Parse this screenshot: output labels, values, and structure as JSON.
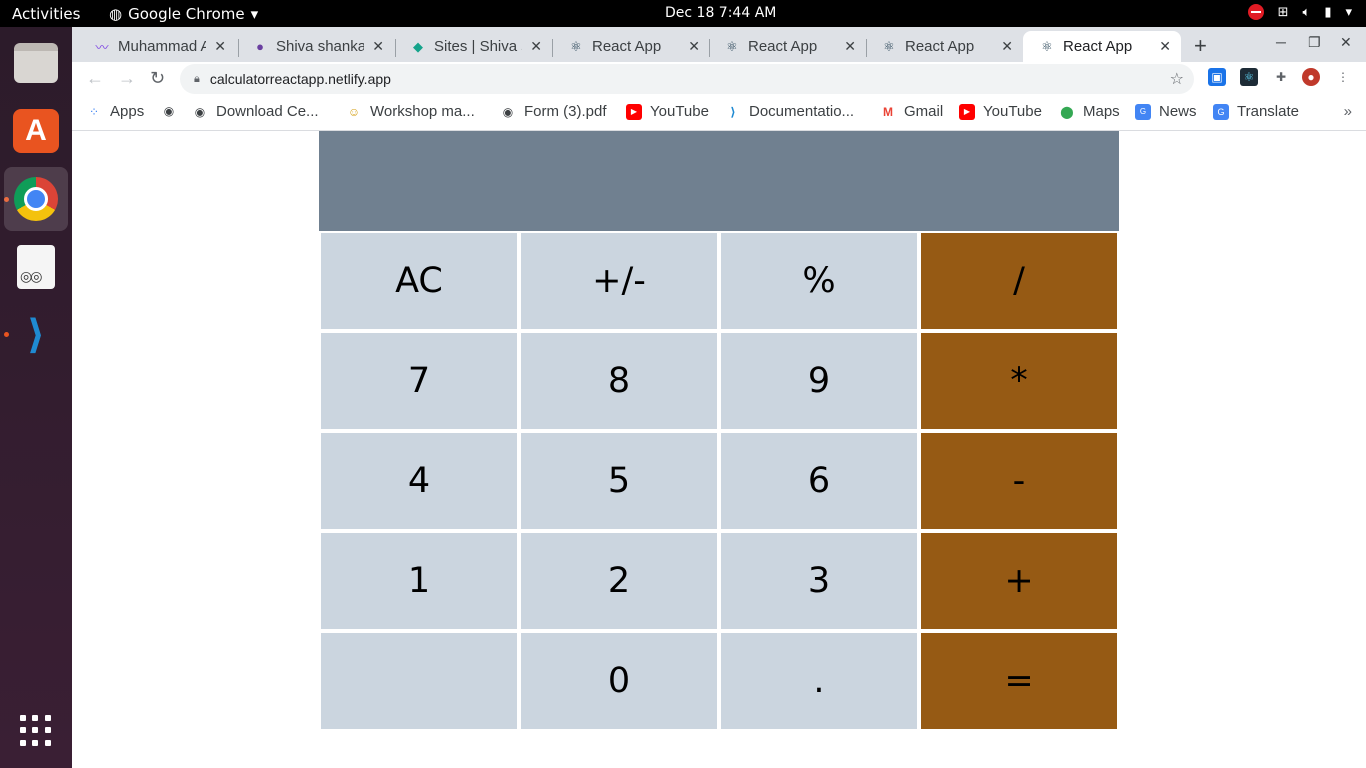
{
  "topbar": {
    "activities": "Activities",
    "app_name": "Google Chrome",
    "clock": "Dec 18  7:44 AM"
  },
  "dock": {
    "items": [
      "files-icon",
      "software-store-icon",
      "chrome-icon",
      "document-reader-icon",
      "vscode-icon",
      "app-grid-icon"
    ]
  },
  "browser": {
    "tabs": [
      {
        "title": "Muhammad A",
        "favicon": "pulse-icon"
      },
      {
        "title": "Shiva shanka",
        "favicon": "avatar-icon"
      },
      {
        "title": "Sites | Shiva sh",
        "favicon": "netlify-icon"
      },
      {
        "title": "React App",
        "favicon": "react-icon"
      },
      {
        "title": "React App",
        "favicon": "react-icon"
      },
      {
        "title": "React App",
        "favicon": "react-icon"
      },
      {
        "title": "React App",
        "favicon": "react-icon"
      }
    ],
    "address": "calculatorreactapp.netlify.app",
    "bookmarks": [
      {
        "label": "Apps",
        "icon": "apps-grid-icon"
      },
      {
        "label": "",
        "icon": "globe-icon"
      },
      {
        "label": "Download Ce...",
        "icon": "globe-icon"
      },
      {
        "label": "Workshop ma...",
        "icon": "people-icon"
      },
      {
        "label": "Form (3).pdf",
        "icon": "globe-icon"
      },
      {
        "label": "YouTube",
        "icon": "youtube-icon"
      },
      {
        "label": "Documentatio...",
        "icon": "vscode-icon"
      },
      {
        "label": "Gmail",
        "icon": "gmail-icon"
      },
      {
        "label": "YouTube",
        "icon": "youtube-icon"
      },
      {
        "label": "Maps",
        "icon": "maps-icon"
      },
      {
        "label": "News",
        "icon": "news-icon"
      },
      {
        "label": "Translate",
        "icon": "translate-icon"
      }
    ]
  },
  "calculator": {
    "display": "",
    "keys": [
      {
        "label": "AC",
        "op": false
      },
      {
        "label": "+/-",
        "op": false
      },
      {
        "label": "%",
        "op": false
      },
      {
        "label": "/",
        "op": true
      },
      {
        "label": "7",
        "op": false
      },
      {
        "label": "8",
        "op": false
      },
      {
        "label": "9",
        "op": false
      },
      {
        "label": "*",
        "op": true
      },
      {
        "label": "4",
        "op": false
      },
      {
        "label": "5",
        "op": false
      },
      {
        "label": "6",
        "op": false
      },
      {
        "label": "-",
        "op": true
      },
      {
        "label": "1",
        "op": false
      },
      {
        "label": "2",
        "op": false
      },
      {
        "label": "3",
        "op": false
      },
      {
        "label": "+",
        "op": true
      },
      {
        "label": "",
        "op": false
      },
      {
        "label": "0",
        "op": false
      },
      {
        "label": ".",
        "op": false
      },
      {
        "label": "=",
        "op": true
      }
    ],
    "colors": {
      "display": "#708090",
      "key": "#cbd5df",
      "operator": "#965a14"
    }
  }
}
